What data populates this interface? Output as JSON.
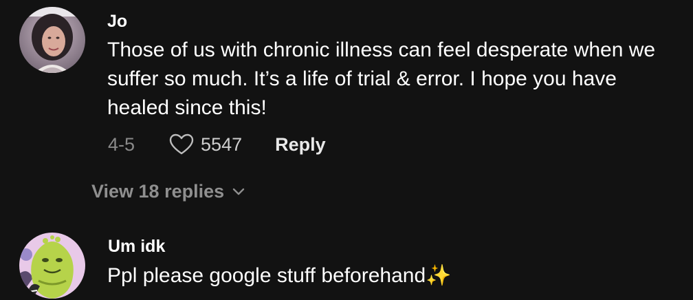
{
  "comments": [
    {
      "username": "Jo",
      "lines": [
        "Those of us with chronic illness can feel desperate when we",
        "suffer so much. It’s a life of trial & error. I hope you have",
        "healed since this!"
      ],
      "date": "4-5",
      "likes": "5547",
      "reply_label": "Reply",
      "view_replies_label": "View 18 replies",
      "avatar_icon": "user-photo-avatar"
    },
    {
      "username": "Um idk",
      "lines": [
        "Ppl please google stuff beforehand✨"
      ],
      "avatar_icon": "cartoon-character-avatar"
    }
  ],
  "colors": {
    "background": "#121212",
    "text": "#ffffff",
    "muted": "#8a8a8a"
  }
}
